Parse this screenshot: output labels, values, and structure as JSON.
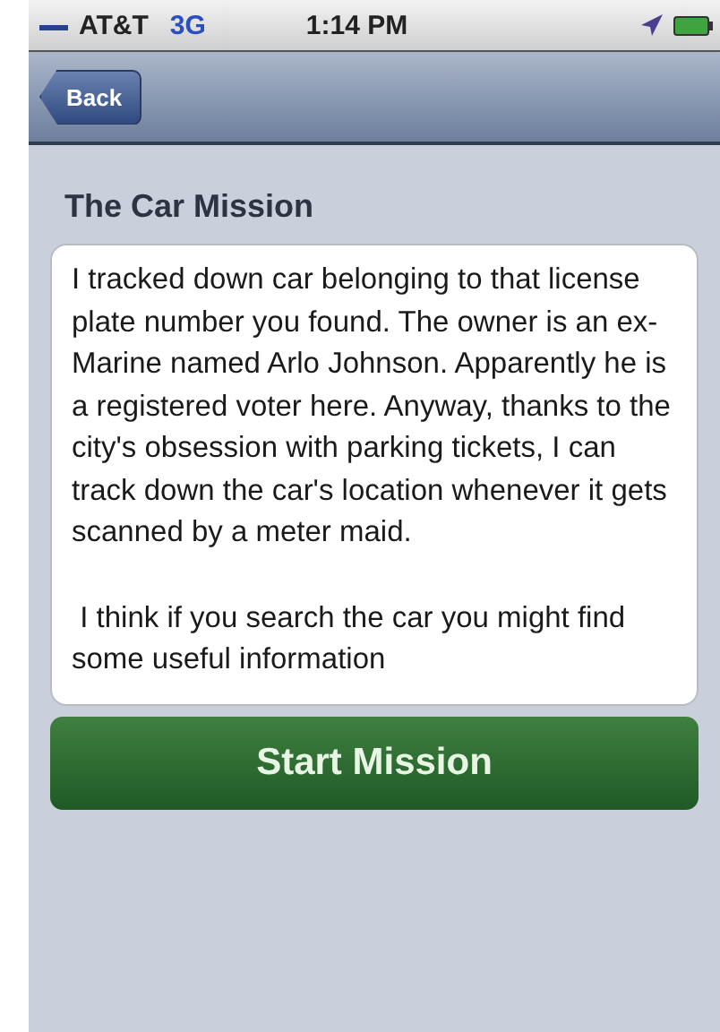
{
  "status_bar": {
    "carrier": "AT&T",
    "network": "3G",
    "time": "1:14 PM"
  },
  "nav_bar": {
    "back_button": "Back"
  },
  "title": "The Car Mission",
  "message": [
    "I tracked down car belonging to that license plate number you found. The owner is an ex-Marine named Arlo Johnson. Apparently he is a registered voter here. Anyway, thanks to the city's obsession with parking tickets, I can track down the car's location whenever it gets scanned by a meter maid.",
    " I think if you search the car you might find some useful information"
  ],
  "action_button": "Start Mission"
}
